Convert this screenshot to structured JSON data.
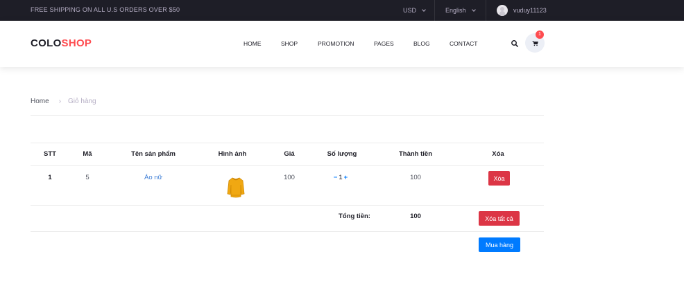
{
  "topbar": {
    "shipping_text": "FREE SHIPPING ON ALL U.S ORDERS OVER $50",
    "currency": "USD",
    "language": "English",
    "username": "vuduy11123"
  },
  "header": {
    "logo_part1": "COLO",
    "logo_part2": "SHOP",
    "nav": [
      "HOME",
      "SHOP",
      "PROMOTION",
      "PAGES",
      "BLOG",
      "CONTACT"
    ],
    "cart_count": "1"
  },
  "breadcrumb": {
    "home": "Home",
    "separator": "›",
    "current": "Giỏ hàng"
  },
  "cart_table": {
    "headers": [
      "STT",
      "Mã",
      "Tên sản phẩm",
      "Hình ảnh",
      "Giá",
      "Số lượng",
      "Thành tiền",
      "Xóa"
    ],
    "rows": [
      {
        "stt": "1",
        "code": "5",
        "name": "Áo nữ",
        "image_icon": "yellow-sweater",
        "price": "100",
        "qty_minus": "−",
        "qty": "1",
        "qty_plus": "+",
        "subtotal": "100",
        "delete_label": "Xóa"
      }
    ],
    "total_label": "Tổng tiền:",
    "total_value": "100",
    "delete_all_label": "Xóa tất cả",
    "checkout_label": "Mua hàng"
  },
  "colors": {
    "accent": "#fe4c50",
    "topbar_bg": "#1e1e27",
    "danger": "#dc3545",
    "primary": "#007bff"
  }
}
